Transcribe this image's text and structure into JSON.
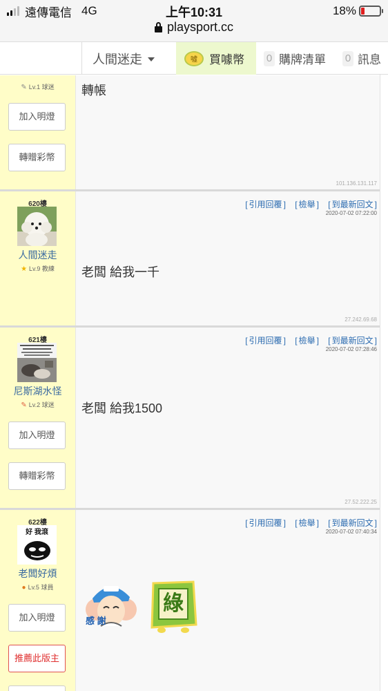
{
  "status_bar": {
    "carrier": "遠傳電信",
    "network": "4G",
    "time": "上午10:31",
    "battery_percent_text": "18%",
    "battery_level": 0.18,
    "url": "playsport.cc"
  },
  "nav": {
    "user_name": "人間迷走",
    "coin_icon_text": "噓",
    "buy_coin_label": "買噱幣",
    "order_count": "0",
    "order_label": "購牌清單",
    "message_count": "0",
    "message_label": "訊息"
  },
  "posts": [
    {
      "level": "Lv.1 球迷",
      "level_icon": "pencil-icon",
      "content": "轉帳",
      "ip": "101.136.131.117",
      "buttons": [
        "加入明燈",
        "轉贈彩幣"
      ]
    },
    {
      "floor": "620樓",
      "author": "人間迷走",
      "level": "Lv.9 教練",
      "level_icon": "star-icon",
      "actions": [
        "引用回覆",
        "檢舉",
        "到最新回文"
      ],
      "time": "2020-07-02 07:22:00",
      "content": "老闆 給我一千",
      "ip": "27.242.69.68"
    },
    {
      "floor": "621樓",
      "author": "尼斯湖水怪",
      "level": "Lv.2 球迷",
      "level_icon": "pencil-icon",
      "actions": [
        "引用回覆",
        "檢舉",
        "到最新回文"
      ],
      "time": "2020-07-02 07:28:46",
      "content": "老闆 給我1500",
      "ip": "27.52.222.25",
      "buttons": [
        "加入明燈",
        "轉贈彩幣"
      ]
    },
    {
      "floor": "622樓",
      "author": "老闆好煩",
      "level": "Lv.5 球員",
      "level_icon": "helmet-icon",
      "avatar_text": "好 我滾",
      "actions": [
        "引用回覆",
        "檢舉",
        "到最新回文"
      ],
      "time": "2020-07-02 07:40:34",
      "sticker_thanks_text": "感 謝",
      "sticker_green_text": "綠",
      "buttons": [
        "加入明燈",
        "推薦此版主"
      ]
    }
  ],
  "colors": {
    "sidebar_bg": "#fffdc8",
    "link_blue": "#2b6bb0",
    "author_blue": "#3a6aa0",
    "coin_tab_bg": "#edf8ce",
    "recommend_red": "#e03030"
  }
}
